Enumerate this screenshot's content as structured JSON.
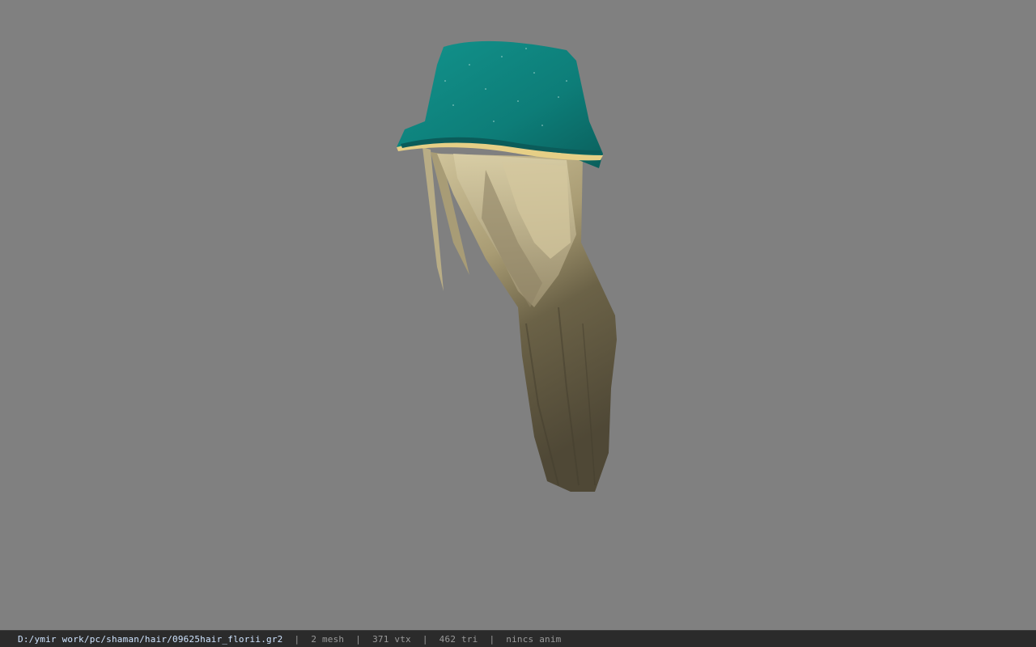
{
  "viewer": {
    "background_color": "#808080",
    "model": {
      "description_icon": "hair-with-bucket-hat-model",
      "hat_color": "#0f8a86",
      "trim_color": "#e6cf86",
      "hair_light_color": "#bdb08a",
      "hair_dark_color": "#5e5741"
    }
  },
  "status_bar": {
    "file_path": "D:/ymir work/pc/shaman/hair/09625hair_florii.gr2",
    "separator": "|",
    "mesh_count": "2 mesh",
    "vertex_count": "371 vtx",
    "triangle_count": "462 tri",
    "anim_status": "nincs anim"
  }
}
